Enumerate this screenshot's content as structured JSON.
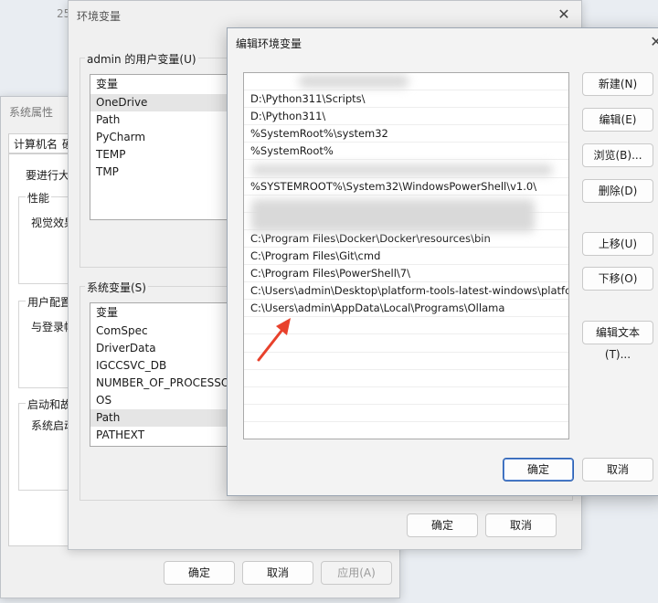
{
  "background": {
    "corner_text": "25"
  },
  "system_properties": {
    "title": "系统属性",
    "tabs": [
      "计算机名",
      "硬"
    ],
    "intro": "要进行大多",
    "groups": [
      {
        "label": "性能",
        "text": "视觉效果"
      },
      {
        "label": "用户配置文",
        "text": "与登录帐"
      },
      {
        "label": "启动和故障",
        "text": "系统启动"
      }
    ],
    "buttons": {
      "ok": "确定",
      "cancel": "取消",
      "apply": "应用(A)"
    }
  },
  "environment_variables": {
    "title": "环境变量",
    "user_section_label": "admin 的用户变量(U)",
    "user_header": "变量",
    "user_vars": [
      "OneDrive",
      "Path",
      "PyCharm",
      "TEMP",
      "TMP"
    ],
    "system_section_label": "系统变量(S)",
    "system_header": "变量",
    "system_vars": [
      "ComSpec",
      "DriverData",
      "IGCCSVC_DB",
      "NUMBER_OF_PROCESSORS",
      "OS",
      "Path",
      "PATHEXT"
    ],
    "buttons": {
      "ok": "确定",
      "cancel": "取消"
    }
  },
  "edit_environment_variable": {
    "title": "编辑环境变量",
    "entries": [
      "",
      "D:\\Python311\\Scripts\\",
      "D:\\Python311\\",
      "%SystemRoot%\\system32",
      "%SystemRoot%",
      "",
      "%SYSTEMROOT%\\System32\\WindowsPowerShell\\v1.0\\",
      "",
      "",
      "C:\\Program Files\\Docker\\Docker\\resources\\bin",
      "C:\\Program Files\\Git\\cmd",
      "C:\\Program Files\\PowerShell\\7\\",
      "C:\\Users\\admin\\Desktop\\platform-tools-latest-windows\\platfor...",
      "C:\\Users\\admin\\AppData\\Local\\Programs\\Ollama"
    ],
    "buttons": {
      "new": "新建(N)",
      "edit": "编辑(E)",
      "browse": "浏览(B)...",
      "delete": "删除(D)",
      "move_up": "上移(U)",
      "move_down": "下移(O)",
      "edit_text": "编辑文本(T)...",
      "ok": "确定",
      "cancel": "取消"
    },
    "annotation_arrow_color": "#e8412c"
  }
}
